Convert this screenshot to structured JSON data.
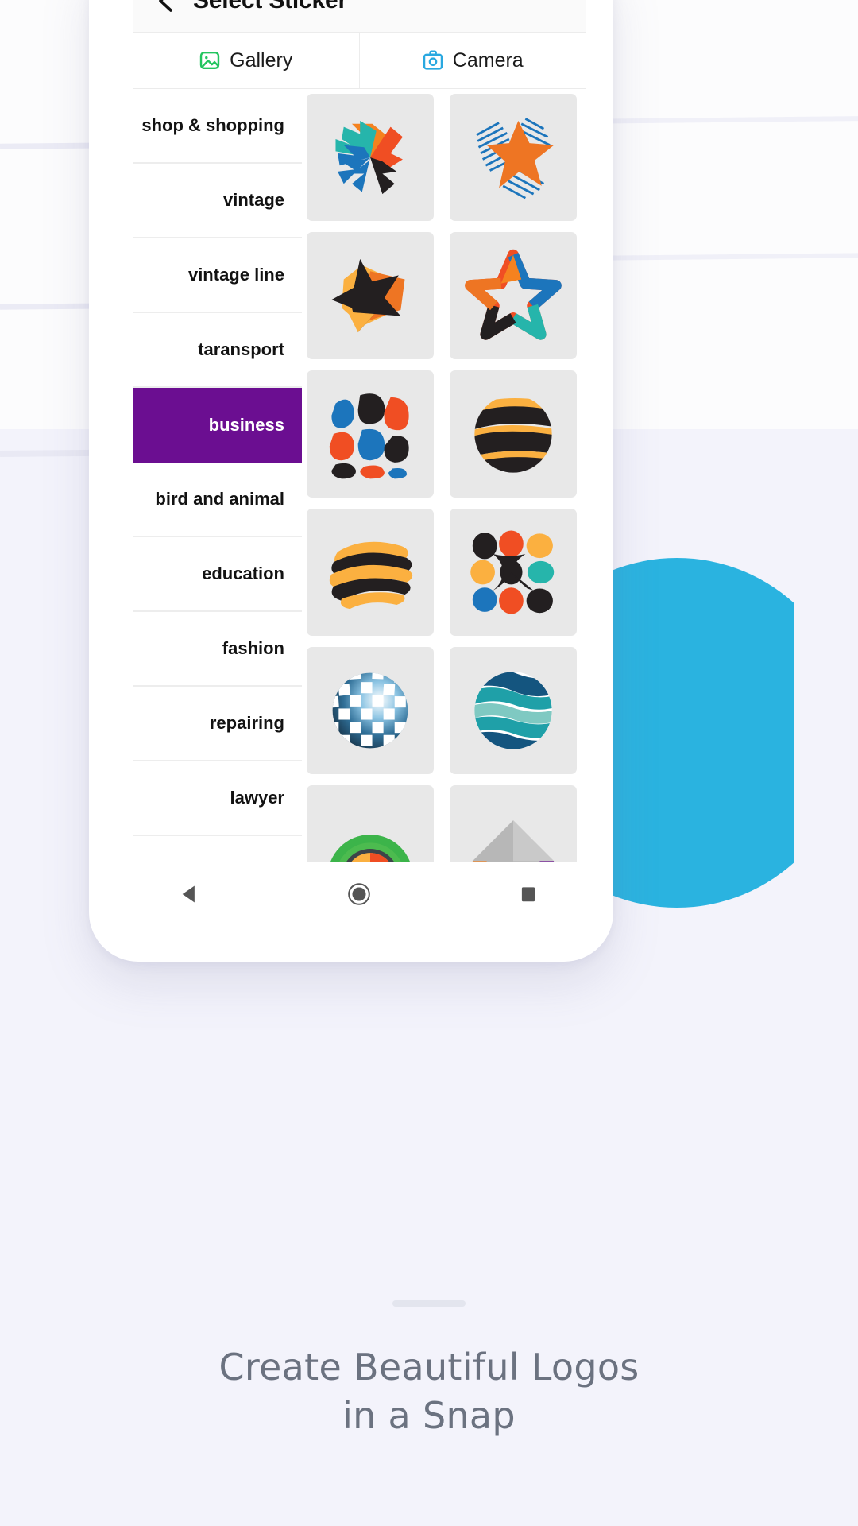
{
  "header": {
    "title": "Select Sticker",
    "back_icon": "chevron-left-icon"
  },
  "tabs": [
    {
      "label": "Gallery",
      "icon": "image-icon",
      "icon_color": "#22c55e",
      "active": true
    },
    {
      "label": "Camera",
      "icon": "camera-icon",
      "icon_color": "#29a8e0",
      "active": false
    }
  ],
  "categories": [
    {
      "label": "shop & shopping",
      "active": false
    },
    {
      "label": "vintage",
      "active": false
    },
    {
      "label": "vintage line",
      "active": false
    },
    {
      "label": "taransport",
      "active": false
    },
    {
      "label": "business",
      "active": true
    },
    {
      "label": "bird and animal",
      "active": false
    },
    {
      "label": "education",
      "active": false
    },
    {
      "label": "fashion",
      "active": false
    },
    {
      "label": "repairing",
      "active": false
    },
    {
      "label": "lawyer",
      "active": false
    }
  ],
  "stickers": [
    {
      "id": "sticker-pinwheel-arrows",
      "alt": "multicolor pinwheel arrow burst"
    },
    {
      "id": "sticker-striped-star",
      "alt": "orange star with blue line rays"
    },
    {
      "id": "sticker-black-star-cube",
      "alt": "black star over orange 3d cube"
    },
    {
      "id": "sticker-outline-star",
      "alt": "multicolor ribbon star outline"
    },
    {
      "id": "sticker-blob-square",
      "alt": "red blue black organic blobs"
    },
    {
      "id": "sticker-striped-sphere",
      "alt": "black and yellow striped sphere"
    },
    {
      "id": "sticker-wavy-blob",
      "alt": "yellow and black wavy blob"
    },
    {
      "id": "sticker-petal-cluster",
      "alt": "colored petal cluster flower"
    },
    {
      "id": "sticker-checker-globe",
      "alt": "blue checkered glossy globe"
    },
    {
      "id": "sticker-wave-circle",
      "alt": "teal wave circle"
    },
    {
      "id": "sticker-green-arc",
      "alt": "green orange red gauge arc"
    },
    {
      "id": "sticker-gray-diamond",
      "alt": "gray diamond with orange corner"
    }
  ],
  "nav_bar": {
    "back": "triangle-back-icon",
    "home": "circle-home-icon",
    "recents": "square-recents-icon"
  },
  "caption": {
    "line1": "Create Beautiful Logos",
    "line2": "in a Snap"
  },
  "colors": {
    "accent_purple": "#6b0e91",
    "gallery_green": "#22c55e",
    "camera_blue": "#29a8e0",
    "background": "#f3f3fb",
    "circle_blue": "#2ab3e0",
    "caption_gray": "#6b7280"
  }
}
